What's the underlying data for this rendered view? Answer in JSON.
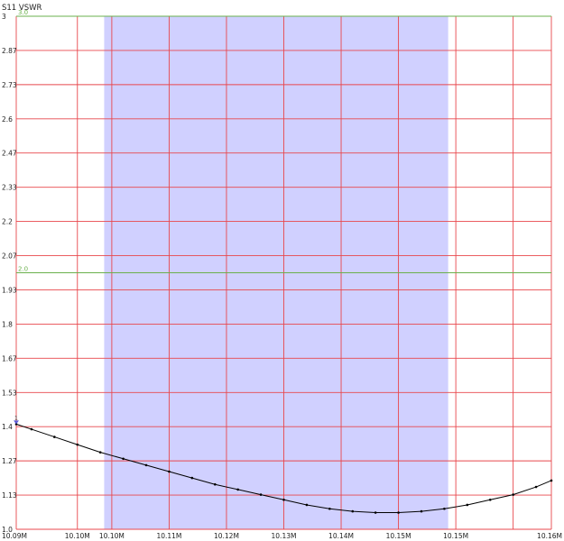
{
  "chart_data": {
    "type": "line",
    "title": "S11 VSWR",
    "xlabel": "",
    "ylabel": "",
    "xlim": [
      10.09,
      10.16
    ],
    "ylim": [
      1.0,
      3.0
    ],
    "grid": true,
    "x_tick_labels": [
      "10.09M",
      "10.10M",
      "10.10M",
      "10.11M",
      "10.12M",
      "10.13M",
      "10.14M",
      "10.15M",
      "10.15M",
      "10.16M"
    ],
    "x_tick_values": [
      10.09,
      10.098,
      10.1025,
      10.11,
      10.1175,
      10.125,
      10.1325,
      10.14,
      10.1475,
      10.155
    ],
    "y_tick_labels": [
      "3",
      "2.87",
      "2.73",
      "2.6",
      "2.47",
      "2.33",
      "2.2",
      "2.07",
      "1.93",
      "1.8",
      "1.67",
      "1.53",
      "1.4",
      "1.27",
      "1.13",
      "1.0"
    ],
    "y_tick_values": [
      3.0,
      2.8667,
      2.7333,
      2.6,
      2.4667,
      2.3333,
      2.2,
      2.0667,
      1.9333,
      1.8,
      1.6667,
      1.5333,
      1.4,
      1.2667,
      1.1333,
      1.0
    ],
    "band": {
      "x_range": [
        10.1015,
        10.1465
      ],
      "color": "#d0d0ff"
    },
    "reference_lines": [
      {
        "y": 3.0,
        "label": "3.0",
        "color": "#6ab04c"
      },
      {
        "y": 2.0,
        "label": "2.0",
        "color": "#6ab04c"
      }
    ],
    "marker": {
      "label": "1",
      "x": 10.09,
      "y": 1.41
    },
    "series": [
      {
        "color": "#000000",
        "x": [
          10.09,
          10.092,
          10.095,
          10.098,
          10.101,
          10.104,
          10.107,
          10.11,
          10.113,
          10.116,
          10.119,
          10.122,
          10.125,
          10.128,
          10.131,
          10.134,
          10.137,
          10.14,
          10.143,
          10.146,
          10.149,
          10.152,
          10.155,
          10.158,
          10.16
        ],
        "y": [
          1.41,
          1.39,
          1.36,
          1.33,
          1.3,
          1.275,
          1.25,
          1.225,
          1.2,
          1.175,
          1.155,
          1.135,
          1.115,
          1.095,
          1.08,
          1.07,
          1.065,
          1.065,
          1.07,
          1.08,
          1.095,
          1.115,
          1.135,
          1.165,
          1.19
        ]
      }
    ]
  }
}
